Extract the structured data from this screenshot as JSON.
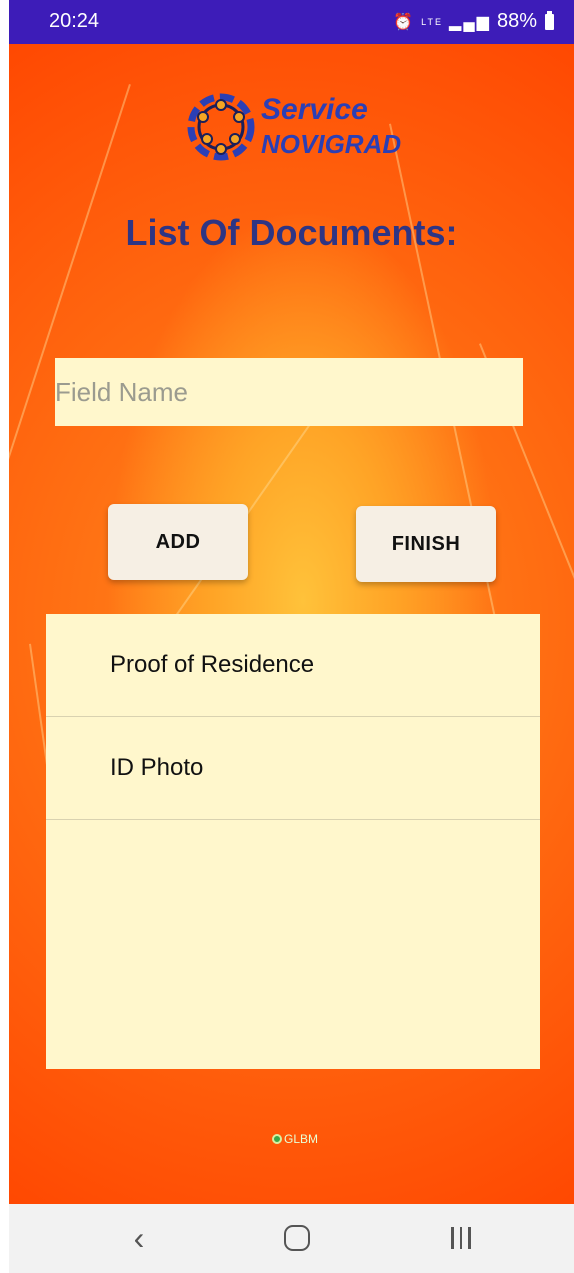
{
  "status_bar": {
    "time": "20:24",
    "battery": "88%",
    "icons": [
      "alarm-icon",
      "lte-icon",
      "signal-icon",
      "battery-icon"
    ]
  },
  "logo": {
    "line1": "Service",
    "line2": "NOVIGRAD"
  },
  "page_title": "List Of Documents:",
  "field_input": {
    "placeholder": "Field Name",
    "value": ""
  },
  "buttons": {
    "add_label": "ADD",
    "finish_label": "FINISH"
  },
  "documents": [
    {
      "label": "Proof of Residence"
    },
    {
      "label": "ID Photo"
    }
  ],
  "brand": "GLBM",
  "colors": {
    "status_bar": "#3d1cb8",
    "title": "#2e3584",
    "logo_blue": "#2b3fb5",
    "field_bg": "#fff7cc",
    "button_bg": "#f6efe4",
    "background_orange": "#ff5a0a"
  }
}
